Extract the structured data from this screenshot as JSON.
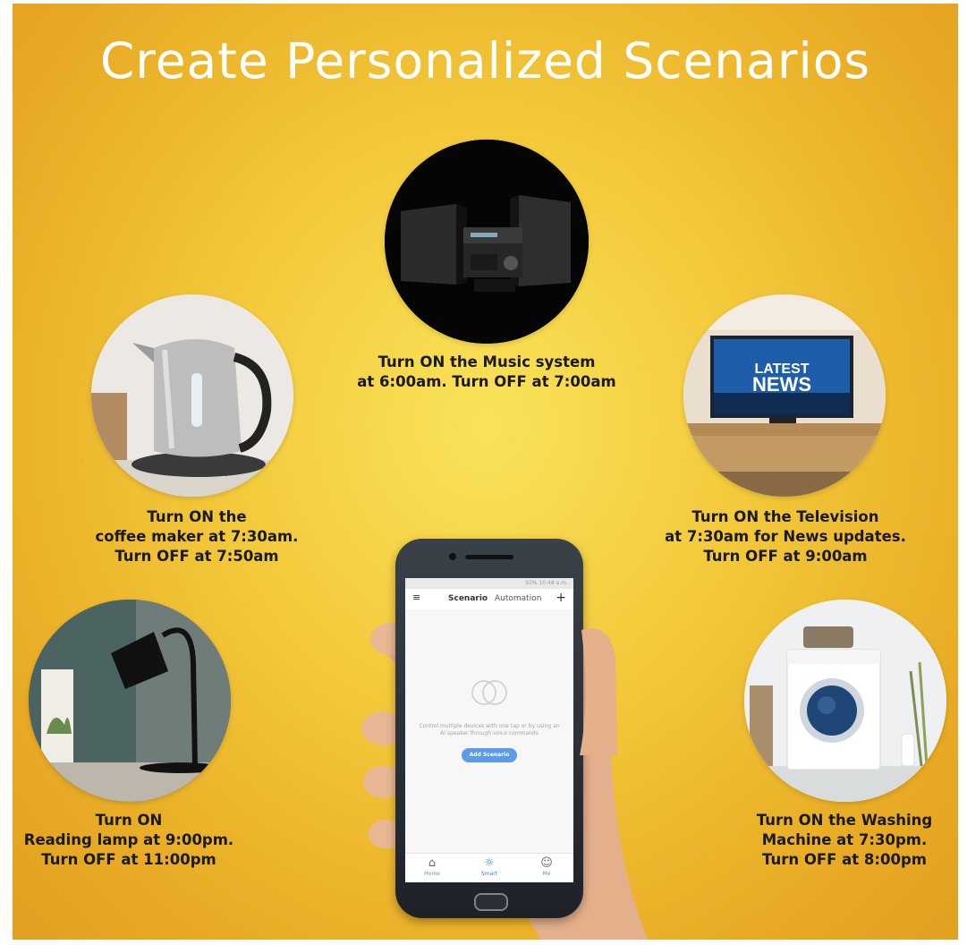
{
  "title": "Create Personalized Scenarios",
  "scenarios": {
    "music": [
      "Turn ON the Music system",
      "at 6:00am. Turn OFF at 7:00am"
    ],
    "coffee": [
      "Turn ON the",
      "coffee maker at 7:30am.",
      "Turn OFF at 7:50am"
    ],
    "tv": [
      "Turn ON the Television",
      "at 7:30am for News updates.",
      "Turn OFF at 9:00am"
    ],
    "lamp": [
      "Turn ON",
      "Reading lamp at 9:00pm.",
      "Turn OFF at 11:00pm"
    ],
    "washer": [
      "Turn ON the Washing",
      "Machine at 7:30pm.",
      "Turn OFF at 8:00pm"
    ]
  },
  "tv_screen": {
    "line1": "LATEST",
    "line2": "NEWS"
  },
  "phone": {
    "status": "93% 10:48 a.m.",
    "tabs": {
      "scenario": "Scenario",
      "automation": "Automation"
    },
    "empty_message": "Control multiple devices with one tap or by using an AI speaker through voice commands",
    "add_button": "Add Scenario",
    "nav": {
      "home": "Home",
      "smart": "Smart",
      "me": "Me"
    }
  },
  "colors": {
    "background": "#f3c93a",
    "title": "#ffffff",
    "button": "#5b9bea"
  }
}
